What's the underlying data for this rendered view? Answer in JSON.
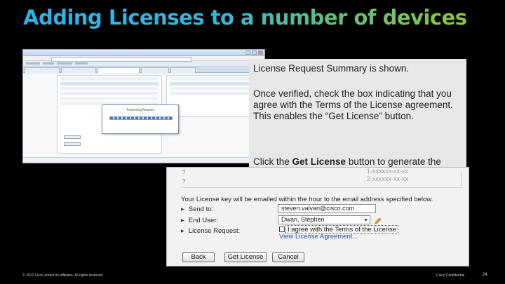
{
  "slide": {
    "title": "Adding Licenses to a number of devices",
    "footer_copyright": "© 2012 Cisco and/or its affiliates. All rights reserved.",
    "footer_confidential": "Cisco Confidential",
    "page_number": "24"
  },
  "callout": {
    "p1": "License Request Summary is shown.",
    "p2_line1": "Once verified, check the box indicating that you agree with the Terms of the License agreement.",
    "p2_line2": "This enables the “Get License” button.",
    "p3_prefix": "Click the ",
    "p3_bold": "Get License",
    "p3_suffix": " button to generate the license."
  },
  "screenshot_browser": {
    "dialog_title": "Processing Request"
  },
  "license_form": {
    "faint_text_1": "1-xxxxxx-xx-xx",
    "faint_text_2": "2-xxxxxx-xx-xx",
    "info_text": "Your License key will be emailed within the hour to the email address specified below.",
    "send_to_label": "Send to:",
    "send_to_value": "steven.valvari@cisco.com",
    "end_user_label": "End User:",
    "end_user_value": "Dwan, Stephen",
    "license_request_label": "License Request:",
    "agree_label": "I agree with the Terms of the License",
    "agreement_link": "View License Agreement...",
    "back_button": "Back",
    "get_license_button": "Get License",
    "cancel_button": "Cancel",
    "colors": {
      "link": "#2a4fa6"
    }
  },
  "colors": {
    "title_gradient_start": "#2bb3ea",
    "title_gradient_end": "#8dc63f",
    "callout_bg": "#e7e7ea"
  }
}
